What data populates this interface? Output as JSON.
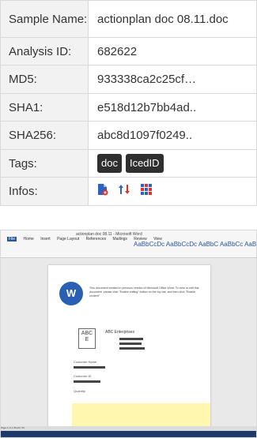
{
  "rows": [
    {
      "label": "Sample Name:",
      "value": "actionplan doc 08.11.doc"
    },
    {
      "label": "Analysis ID:",
      "value": "682622"
    },
    {
      "label": "MD5:",
      "value": "933338ca2c25cf…"
    },
    {
      "label": "SHA1:",
      "value": "e518d12b7bb4ad.."
    },
    {
      "label": "SHA256:",
      "value": "abc8d1097f0249.."
    },
    {
      "label": "Tags:",
      "tags": [
        "doc",
        "IcedID"
      ]
    },
    {
      "label": "Infos:",
      "icons": [
        "document-red-icon",
        "arrows-up-down-icon",
        "grid-colored-icon"
      ]
    }
  ],
  "screenshot": {
    "title": "actionplan doc 08.11 - Microsoft Word",
    "tabs": [
      "File",
      "Home",
      "Insert",
      "Page Layout",
      "References",
      "Mailings",
      "Review",
      "View"
    ],
    "styles": "AaBbCcDc AaBbCcDc AaBbC AaBbCc AaB AaBbCc",
    "doc_text": "This document created in previous version of Microsoft Office Word. To view or edit this document, please click \"Enable editing\" button on the top bar, and then click \"Enable content\"",
    "company": "ABC Enterprises",
    "customer_name_label": "Customer Name",
    "customer_id_label": "Customer ID",
    "quantity_label": "Quantity",
    "status": "Page 1 of 1   Words: 53"
  }
}
